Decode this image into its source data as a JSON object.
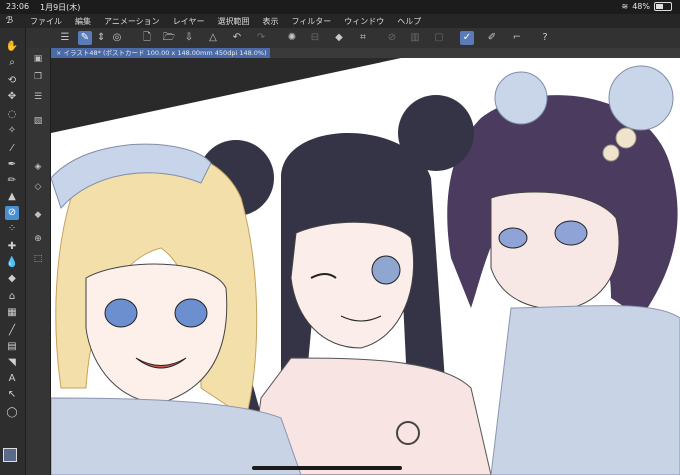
{
  "status": {
    "time": "23:06",
    "date": "1月9日(木)",
    "battery": "48%",
    "battery_level": 0.48
  },
  "menu": {
    "items": [
      "ファイル",
      "編集",
      "アニメーション",
      "レイヤー",
      "選択範囲",
      "表示",
      "フィルター",
      "ウィンドウ",
      "ヘルプ"
    ]
  },
  "document": {
    "tab_title": "イラスト48* (ポストカード 100.00 x 148.00mm 450dpi 148.0%)"
  },
  "colors": {
    "main": "#5b6a8c",
    "sub": "#111111",
    "accent": "#4a8fd0"
  },
  "toolbar_icons": [
    "menu-icon",
    "select-tool-icon",
    "stepper-icon",
    "pen-settings-icon",
    "new-file-icon",
    "open-file-icon",
    "save-icon",
    "undo-icon",
    "redo-icon",
    "loading-icon",
    "transform-icon",
    "fill-icon",
    "crop-icon",
    "ruler-icon",
    "snap-icon",
    "grid-icon",
    "check-icon",
    "brush-icon",
    "eraser-icon",
    "help-icon"
  ]
}
